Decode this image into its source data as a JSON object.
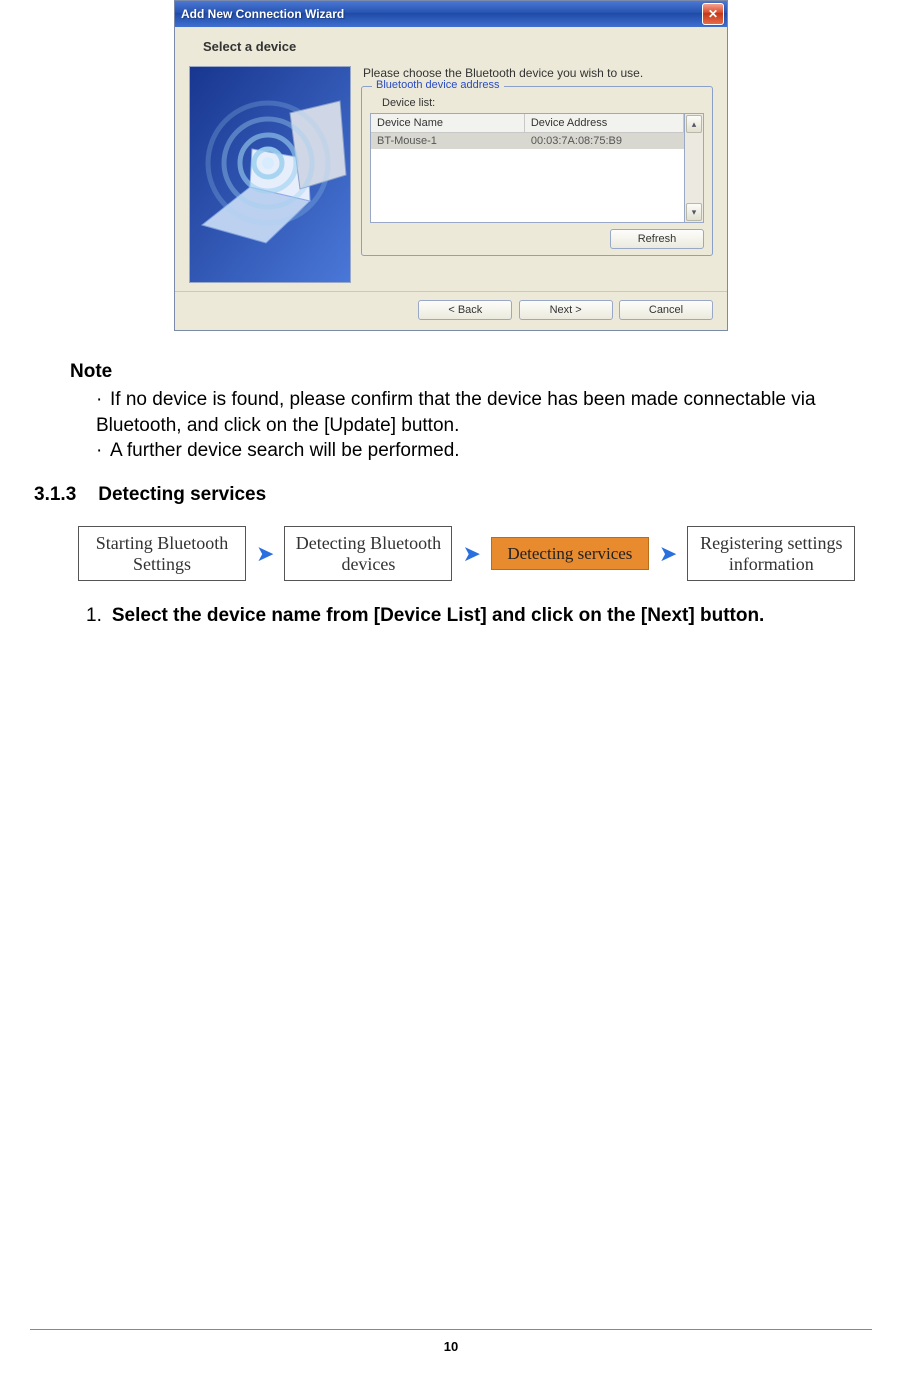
{
  "wizard": {
    "title": "Add New Connection Wizard",
    "step_title": "Select a device",
    "instruction": "Please choose the Bluetooth device you wish to use.",
    "group_legend": "Bluetooth device address",
    "device_list_label": "Device list:",
    "columns": {
      "name": "Device Name",
      "address": "Device Address"
    },
    "devices": [
      {
        "name": "BT-Mouse-1",
        "address": "00:03:7A:08:75:B9"
      }
    ],
    "refresh_label": "Refresh",
    "back_label": "< Back",
    "next_label": "Next >",
    "cancel_label": "Cancel"
  },
  "note": {
    "heading": "Note",
    "line1": "If no device is found, please confirm that the device has been made connectable via Bluetooth, and click on the [Update] button.",
    "line2": "A further device search will be performed."
  },
  "section": {
    "number": "3.1.3",
    "title": "Detecting services"
  },
  "flow": {
    "b1": "Starting Bluetooth Settings",
    "b2": "Detecting Bluetooth devices",
    "b3": "Detecting services",
    "b4": "Registering settings information"
  },
  "step1": {
    "num": "1.",
    "text": "Select the device name from [Device List] and click on the [Next] button."
  },
  "page_number": "10"
}
